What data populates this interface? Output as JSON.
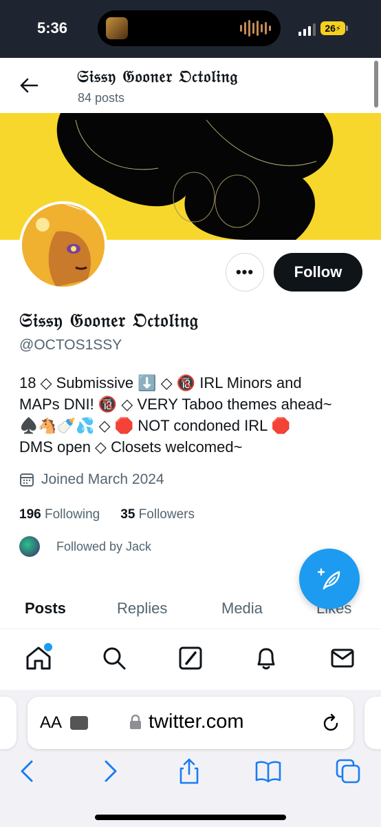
{
  "status": {
    "time": "5:36",
    "battery": "26"
  },
  "header": {
    "title": "𝔖𝔦𝔰𝔰𝔶 𝔊𝔬𝔬𝔫𝔢𝔯 𝔒𝔠𝔱𝔬𝔩𝔦𝔫𝔤",
    "posts": "84 posts"
  },
  "profile": {
    "display_name": "𝔖𝔦𝔰𝔰𝔶 𝔊𝔬𝔬𝔫𝔢𝔯 𝔒𝔠𝔱𝔬𝔩𝔦𝔫𝔤",
    "handle": "@OCTOS1SSY",
    "bio_line1": "18 ◇ Submissive ⬇️ ◇ 🔞 IRL Minors and",
    "bio_line2": "MAPs DNI! 🔞 ◇ VERY Taboo themes ahead~",
    "bio_line3": "♠️🐴🍼💦 ◇ 🛑 NOT condoned IRL 🛑",
    "bio_line4": "DMS open ◇ Closets welcomed~",
    "joined": "Joined March 2024",
    "following_count": "196",
    "following_label": "Following",
    "followers_count": "35",
    "followers_label": "Followers",
    "followed_by": "Followed by Jack"
  },
  "actions": {
    "more": "•••",
    "follow": "Follow"
  },
  "tabs": [
    "Posts",
    "Replies",
    "Media",
    "Likes"
  ],
  "nav": {
    "icons": [
      "home-icon",
      "search-icon",
      "grok-icon",
      "bell-icon",
      "mail-icon"
    ]
  },
  "browser": {
    "aa": "AA",
    "url": "twitter.com"
  },
  "colors": {
    "accent": "#1d9bf0",
    "banner": "#f7d72c",
    "follow_bg": "#0f1419"
  }
}
